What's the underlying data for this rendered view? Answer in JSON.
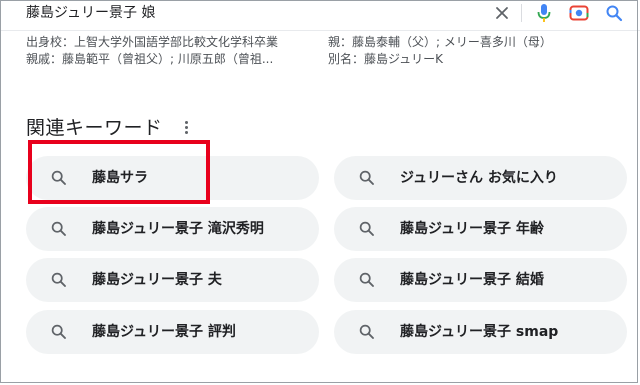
{
  "search": {
    "query": "藤島ジュリー景子 娘"
  },
  "meta": {
    "line1_left": "出身校：上智大学外国語学部比較文化学科卒業",
    "line1_right": "親：藤島泰輔（父）; メリー喜多川（母）",
    "line2_left": "親戚：藤島範平（曾祖父）; 川原五郎（曾祖...",
    "line2_right": "別名：藤島ジュリーK"
  },
  "related": {
    "title": "関連キーワード",
    "chips": [
      {
        "label": "藤島サラ"
      },
      {
        "label": "ジュリーさん お気に入り"
      },
      {
        "label": "藤島ジュリー景子 滝沢秀明"
      },
      {
        "label": "藤島ジュリー景子 年齢"
      },
      {
        "label": "藤島ジュリー景子 夫"
      },
      {
        "label": "藤島ジュリー景子 結婚"
      },
      {
        "label": "藤島ジュリー景子 評判"
      },
      {
        "label": "藤島ジュリー景子 smap"
      }
    ]
  },
  "colors": {
    "highlight": "#e8001c",
    "chip_bg": "#f1f3f4",
    "icon_blue": "#4285f4"
  },
  "icons": [
    "close-icon",
    "microphone-icon",
    "lens-camera-icon",
    "search-icon",
    "more-vert-icon"
  ]
}
